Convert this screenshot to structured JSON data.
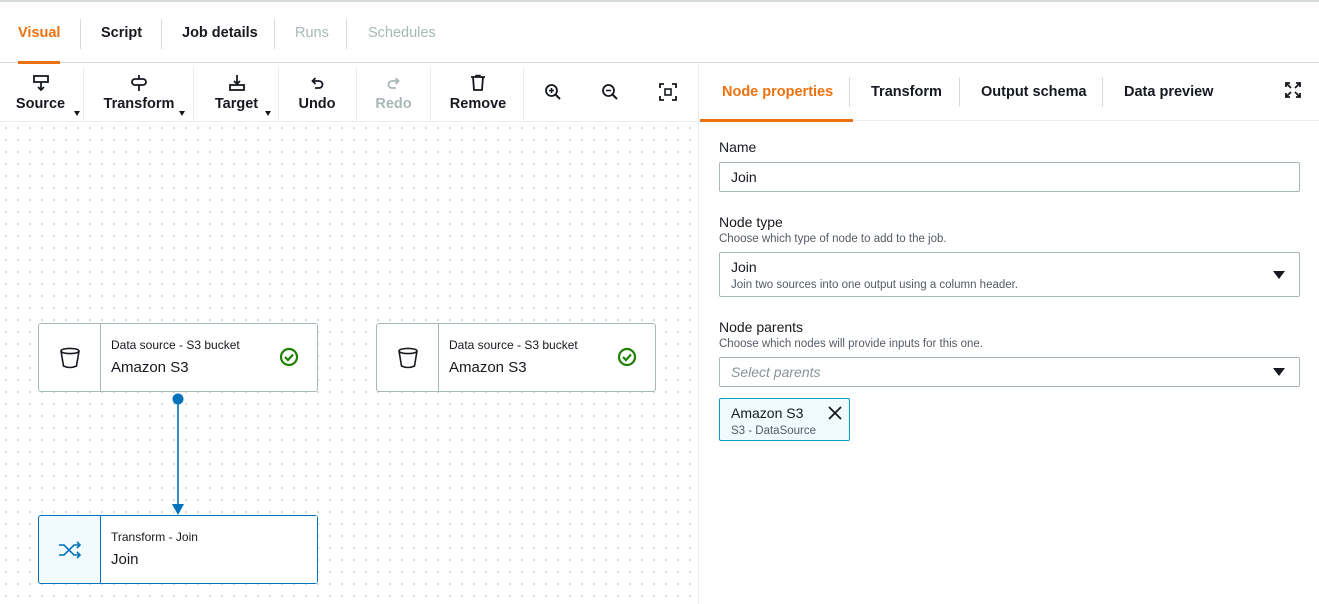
{
  "top_tabs": [
    {
      "label": "Visual"
    },
    {
      "label": "Script"
    },
    {
      "label": "Job details"
    },
    {
      "label": "Runs"
    },
    {
      "label": "Schedules"
    }
  ],
  "toolbar": {
    "source": "Source",
    "transform": "Transform",
    "target": "Target",
    "undo": "Undo",
    "redo": "Redo",
    "remove": "Remove"
  },
  "canvas": {
    "nodes": [
      {
        "subtitle": "Data source - S3 bucket",
        "title": "Amazon S3",
        "icon": "bucket-icon",
        "status": "check-circle-icon"
      },
      {
        "subtitle": "Data source - S3 bucket",
        "title": "Amazon S3",
        "icon": "bucket-icon",
        "status": "check-circle-icon"
      },
      {
        "subtitle": "Transform - Join",
        "title": "Join",
        "icon": "shuffle-icon"
      }
    ]
  },
  "panel": {
    "tabs": [
      {
        "label": "Node properties"
      },
      {
        "label": "Transform"
      },
      {
        "label": "Output schema"
      },
      {
        "label": "Data preview"
      }
    ],
    "name_label": "Name",
    "name_value": "Join",
    "node_type_label": "Node type",
    "node_type_hint": "Choose which type of node to add to the job.",
    "node_type_value": "Join",
    "node_type_desc": "Join two sources into one output using a column header.",
    "parents_label": "Node parents",
    "parents_hint": "Choose which nodes will provide inputs for this one.",
    "parents_placeholder": "Select parents",
    "token_title": "Amazon S3",
    "token_sub": "S3 - DataSource"
  },
  "colors": {
    "accent": "#ec7211",
    "link_blue": "#0073bb",
    "success": "#1d8102"
  }
}
